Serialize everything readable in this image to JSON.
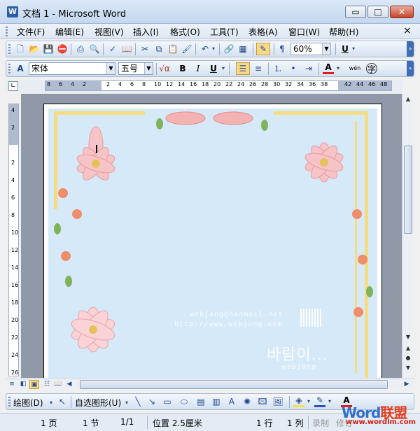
{
  "window": {
    "title": "文档 1 - Microsoft Word",
    "minimize_glyph": "▭",
    "maximize_glyph": "□",
    "close_glyph": "✕"
  },
  "menubar": {
    "items": [
      "文件(F)",
      "编辑(E)",
      "视图(V)",
      "插入(I)",
      "格式(O)",
      "工具(T)",
      "表格(A)",
      "窗口(W)",
      "帮助(H)"
    ],
    "close_doc": "×"
  },
  "standard_toolbar": {
    "zoom": "60%",
    "underline_style": "U"
  },
  "formatting_toolbar": {
    "font_name": "宋体",
    "font_size": "五号",
    "bold": "B",
    "italic": "I",
    "underline": "U",
    "font_color_glyph": "A",
    "phonetic_glyph": "wén",
    "enclose_glyph": "字"
  },
  "ruler": {
    "h_numbers": [
      "8",
      "6",
      "4",
      "2",
      "",
      "2",
      "4",
      "6",
      "8",
      "10",
      "12",
      "14",
      "16",
      "18",
      "20",
      "22",
      "24",
      "26",
      "28",
      "30",
      "32",
      "34",
      "36",
      "38",
      "",
      "42",
      "44",
      "46",
      "48"
    ],
    "v_numbers": [
      "4",
      "2",
      "",
      "2",
      "4",
      "6",
      "8",
      "10",
      "12",
      "14",
      "16",
      "18",
      "20",
      "22",
      "24",
      "26"
    ]
  },
  "document": {
    "watermark_email": "webjong@hanmail.net",
    "watermark_url": "http://www.webjong.com",
    "watermark_signature": "바람이...",
    "watermark_sub": "webjong"
  },
  "drawing_toolbar": {
    "draw_label": "绘图(D)",
    "autoshape_label": "自选图形(U)"
  },
  "statusbar": {
    "page": "1 页",
    "section": "1 节",
    "pages": "1/1",
    "position": "位置 2.5厘米",
    "line": "1 行",
    "column": "1 列",
    "record": "录制",
    "revise": "修订"
  },
  "logo": {
    "brand_a": "Word",
    "brand_b": "联盟",
    "url": "www.wordlm.com"
  },
  "colors": {
    "page_bg": "#d5e9f8",
    "frame": "#f6dc80",
    "flower": "#f4b6b6",
    "accent": "#2f6fd1"
  }
}
